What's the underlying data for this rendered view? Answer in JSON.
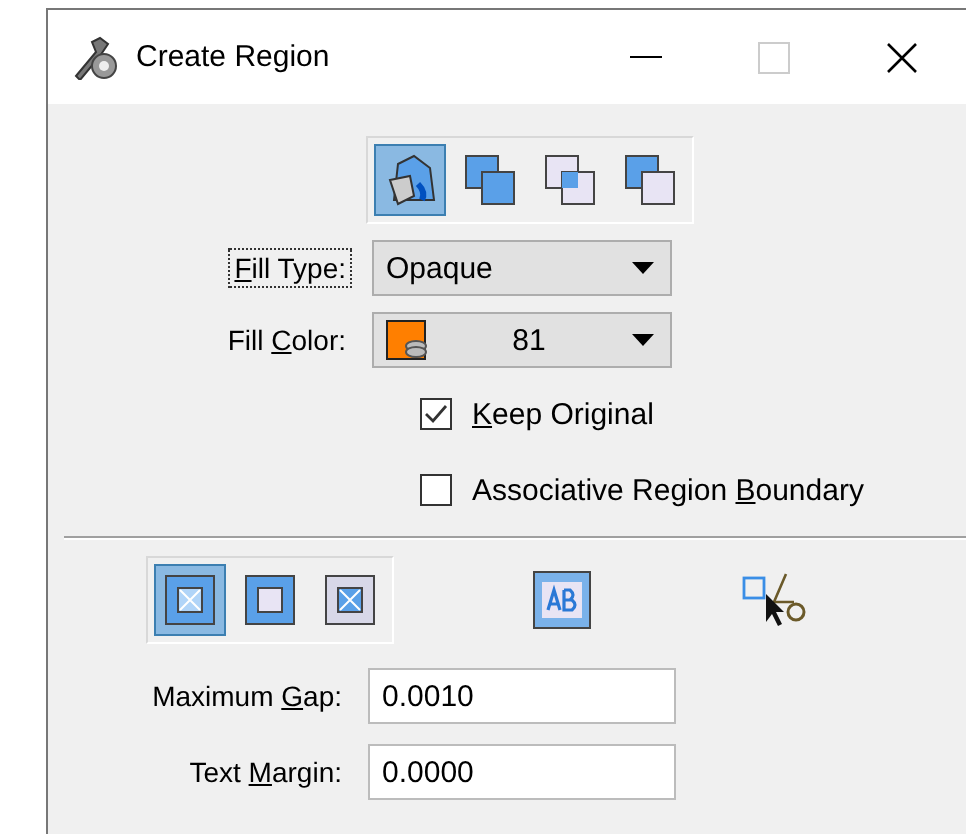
{
  "window": {
    "title": "Create Region"
  },
  "fill_modes": [
    {
      "kind": "flood",
      "selected": true
    },
    {
      "kind": "union",
      "selected": false
    },
    {
      "kind": "intersection",
      "selected": false
    },
    {
      "kind": "difference",
      "selected": false
    }
  ],
  "fill_type": {
    "label": {
      "key": "F",
      "after": "ill Type:"
    },
    "value": "Opaque",
    "focused": true
  },
  "fill_color": {
    "label": {
      "before": "Fill ",
      "key": "C",
      "after": "olor:"
    },
    "value": "81",
    "color": "#ff7f00"
  },
  "checkboxes": [
    {
      "label": {
        "key": "K",
        "after": "eep Original"
      },
      "checked": true
    },
    {
      "label": {
        "before": "Associative Region ",
        "key": "B",
        "after": "oundary"
      },
      "checked": false
    }
  ],
  "boundary_modes": [
    {
      "kind": "holes",
      "selected": true
    },
    {
      "kind": "outer",
      "selected": false
    },
    {
      "kind": "inner",
      "selected": false
    }
  ],
  "fields": [
    {
      "label": {
        "before": "Maximum ",
        "key": "G",
        "after": "ap:"
      },
      "value": "0.0010"
    },
    {
      "label": {
        "before": "Text ",
        "key": "M",
        "after": "argin:"
      },
      "value": "0.0000"
    }
  ]
}
